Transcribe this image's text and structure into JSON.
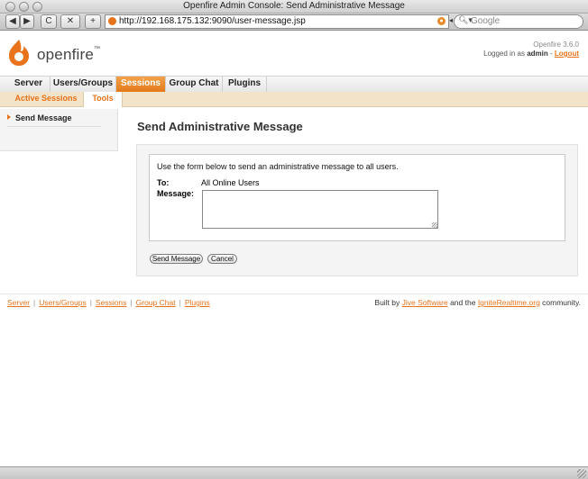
{
  "window": {
    "title": "Openfire Admin Console: Send Administrative Message"
  },
  "browser": {
    "url": "http://192.168.175.132:9090/user-message.jsp",
    "search_placeholder": "Google",
    "buttons": {
      "back": "◀",
      "forward": "▶",
      "reload": "C",
      "stop": "✕",
      "add": "+"
    }
  },
  "header": {
    "logo": "openfire",
    "logo_tm": "™",
    "version": "Openfire 3.6.0",
    "logged_in_prefix": "Logged in as",
    "user": "admin",
    "separator": "-",
    "logout": "Logout"
  },
  "nav": {
    "tabs": [
      {
        "label": "Server"
      },
      {
        "label": "Users/Groups"
      },
      {
        "label": "Sessions",
        "active": true
      },
      {
        "label": "Group Chat"
      },
      {
        "label": "Plugins"
      }
    ]
  },
  "subnav": {
    "tabs": [
      {
        "label": "Active Sessions"
      },
      {
        "label": "Tools",
        "active": true
      }
    ]
  },
  "sidebar": {
    "items": [
      {
        "label": "Send Message"
      }
    ]
  },
  "main": {
    "title": "Send Administrative Message",
    "intro": "Use the form below to send an administrative message to all users.",
    "to_label": "To:",
    "to_value": "All Online Users",
    "message_label": "Message:",
    "message_value": "",
    "send_button": "Send Message",
    "cancel_button": "Cancel"
  },
  "footer": {
    "links": [
      "Server",
      "Users/Groups",
      "Sessions",
      "Group Chat",
      "Plugins"
    ],
    "separator": "|",
    "built_by_prefix": "Built by",
    "jive": "Jive Software",
    "and_the": "and the",
    "ignite": "IgniteRealtime.org",
    "community": "community."
  },
  "colors": {
    "accent": "#e8731a",
    "subnav_bg": "#f2e3c9"
  }
}
